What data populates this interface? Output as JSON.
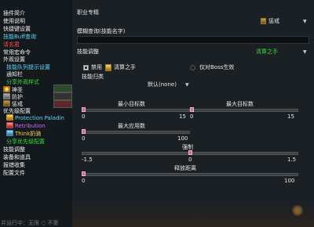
{
  "sidebar": {
    "items": [
      {
        "label": "插件简介",
        "color": "white"
      },
      {
        "label": "使用说明",
        "color": "white"
      },
      {
        "label": "快捷键设置",
        "color": "white"
      },
      {
        "label": "技能Buff查询",
        "color": "cyan"
      },
      {
        "label": "请玄君",
        "color": "red"
      },
      {
        "label": "常用宏命令",
        "color": "white"
      },
      {
        "label": "外观设置",
        "color": "white"
      },
      {
        "label": "技能队列提示设置",
        "color": "cyan"
      },
      {
        "label": "通知栏",
        "color": "white"
      },
      {
        "label": "分享外观样式",
        "color": "green"
      },
      {
        "label": "神圣",
        "color": "white",
        "icon": "sun-icon"
      },
      {
        "label": "防护",
        "color": "white",
        "icon": "shield-icon"
      },
      {
        "label": "惩戒",
        "color": "white",
        "icon": "hammer-icon"
      },
      {
        "label": "优先级配置",
        "color": "white"
      },
      {
        "label": "Protection Paladin",
        "color": "cyan",
        "icon": "paladin-icon"
      },
      {
        "label": "Retribution",
        "color": "purple",
        "icon": "retribution-icon"
      },
      {
        "label": "Think奶骑",
        "color": "yellow",
        "icon": "think-icon"
      },
      {
        "label": "分享优先级配置",
        "color": "green"
      },
      {
        "label": "技能调整",
        "color": "white"
      },
      {
        "label": "装备和道具",
        "color": "white"
      },
      {
        "label": "报错收集",
        "color": "white"
      },
      {
        "label": "配置文件",
        "color": "white"
      }
    ],
    "footer": "并运行中：无限 ○ 不重"
  },
  "main": {
    "spec_label": "职业专精",
    "spec_value": "惩戒",
    "fuzzy_search_label": "模糊查询(技能名字)",
    "fuzzy_search_value": "",
    "skill_adjust_label": "技能调整",
    "skill_adjust_value": "清算之手",
    "disable_label": "禁用",
    "spell_name": "清算之手",
    "boss_only_label": "仅对Boss生效",
    "category_label": "技能归类",
    "category_value": "默认(none)",
    "min_targets": {
      "label": "最小目标数",
      "min": "0",
      "max": "15",
      "value": 0
    },
    "max_targets": {
      "label": "最大目标数",
      "min": "0",
      "max": "15",
      "value": 0
    },
    "max_cast": {
      "label": "最大应用数",
      "min": "0",
      "max": "100",
      "value": 0
    },
    "intensity": {
      "label": "强制",
      "min": "-1.5",
      "center": "0",
      "max": "1.5",
      "value": 0
    },
    "release_distance": {
      "label": "释放距离",
      "min": "0",
      "max": "100",
      "value": 0
    }
  },
  "colors": {
    "white": "#f0f0f0",
    "cyan": "#5ad9ff",
    "red": "#ff4646",
    "green": "#38d938",
    "purple": "#cc66ff",
    "yellow": "#ffd24a",
    "slider_thumb": "#c07090"
  }
}
